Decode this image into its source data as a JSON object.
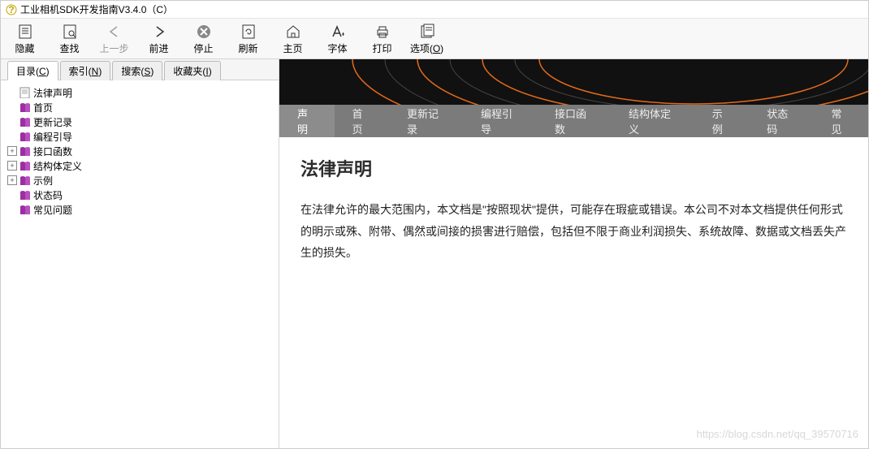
{
  "window": {
    "title": "工业相机SDK开发指南V3.4.0（C）"
  },
  "toolbar": [
    {
      "id": "hide",
      "label": "隐藏",
      "icon": "hide-icon",
      "enabled": true
    },
    {
      "id": "find",
      "label": "查找",
      "icon": "find-icon",
      "enabled": true
    },
    {
      "id": "back",
      "label": "上一步",
      "icon": "back-icon",
      "enabled": false
    },
    {
      "id": "forward",
      "label": "前进",
      "icon": "forward-icon",
      "enabled": true
    },
    {
      "id": "stop",
      "label": "停止",
      "icon": "stop-icon",
      "enabled": true
    },
    {
      "id": "refresh",
      "label": "刷新",
      "icon": "refresh-icon",
      "enabled": true
    },
    {
      "id": "home",
      "label": "主页",
      "icon": "home-icon",
      "enabled": true
    },
    {
      "id": "font",
      "label": "字体",
      "icon": "font-icon",
      "enabled": true
    },
    {
      "id": "print",
      "label": "打印",
      "icon": "print-icon",
      "enabled": true
    },
    {
      "id": "options",
      "label": "选项(O)",
      "icon": "options-icon",
      "enabled": true
    }
  ],
  "left_tabs": [
    {
      "label": "目录",
      "hotkey": "C",
      "active": true
    },
    {
      "label": "索引",
      "hotkey": "N",
      "active": false
    },
    {
      "label": "搜索",
      "hotkey": "S",
      "active": false
    },
    {
      "label": "收藏夹",
      "hotkey": "I",
      "active": false
    }
  ],
  "tree": [
    {
      "label": "法律声明",
      "type": "page",
      "expandable": false
    },
    {
      "label": "首页",
      "type": "book",
      "expandable": false
    },
    {
      "label": "更新记录",
      "type": "book",
      "expandable": false
    },
    {
      "label": "编程引导",
      "type": "book",
      "expandable": false
    },
    {
      "label": "接口函数",
      "type": "book",
      "expandable": true
    },
    {
      "label": "结构体定义",
      "type": "book",
      "expandable": true
    },
    {
      "label": "示例",
      "type": "book",
      "expandable": true
    },
    {
      "label": "状态码",
      "type": "book",
      "expandable": false
    },
    {
      "label": "常见问题",
      "type": "book",
      "expandable": false
    }
  ],
  "content_nav": [
    {
      "label": "声明",
      "active": true
    },
    {
      "label": "首页",
      "active": false
    },
    {
      "label": "更新记录",
      "active": false
    },
    {
      "label": "编程引导",
      "active": false
    },
    {
      "label": "接口函数",
      "active": false
    },
    {
      "label": "结构体定义",
      "active": false
    },
    {
      "label": "示例",
      "active": false
    },
    {
      "label": "状态码",
      "active": false
    },
    {
      "label": "常见",
      "active": false
    }
  ],
  "content": {
    "heading": "法律声明",
    "body": "在法律允许的最大范围内，本文档是\"按照现状\"提供，可能存在瑕疵或错误。本公司不对本文档提供任何形式的明示或殊、附带、偶然或间接的损害进行赔偿，包括但不限于商业利润损失、系统故障、数据或文档丢失产生的损失。"
  },
  "watermark": "https://blog.csdn.net/qq_39570716"
}
